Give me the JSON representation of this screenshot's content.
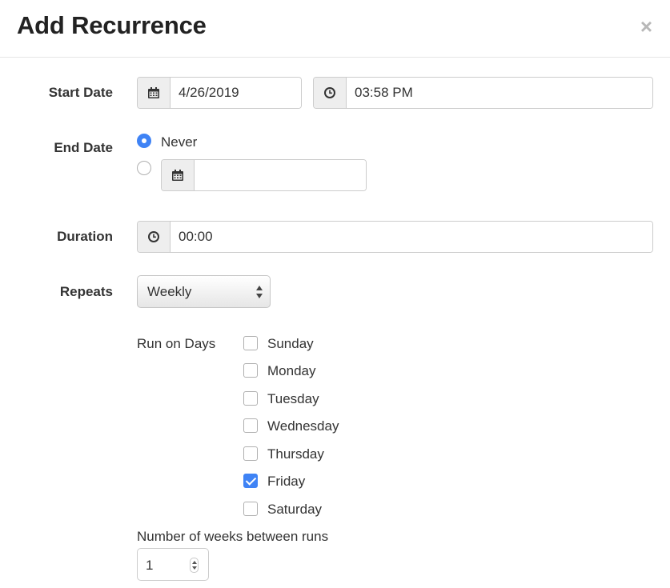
{
  "dialog": {
    "title": "Add Recurrence",
    "close_symbol": "×"
  },
  "start_date": {
    "label": "Start Date",
    "date_value": "4/26/2019",
    "time_value": "03:58 PM",
    "date_icon": "calendar-icon",
    "time_icon": "clock-icon"
  },
  "end_date": {
    "label": "End Date",
    "options": [
      {
        "label": "Never",
        "selected": true
      },
      {
        "label": "",
        "selected": false
      }
    ],
    "date_value": "",
    "date_icon": "calendar-icon"
  },
  "duration": {
    "label": "Duration",
    "value": "00:00",
    "icon": "clock-icon"
  },
  "repeats": {
    "label": "Repeats",
    "selected": "Weekly"
  },
  "run_on_days": {
    "label": "Run on Days",
    "days": [
      {
        "label": "Sunday",
        "checked": false
      },
      {
        "label": "Monday",
        "checked": false
      },
      {
        "label": "Tuesday",
        "checked": false
      },
      {
        "label": "Wednesday",
        "checked": false
      },
      {
        "label": "Thursday",
        "checked": false
      },
      {
        "label": "Friday",
        "checked": true
      },
      {
        "label": "Saturday",
        "checked": false
      }
    ]
  },
  "weeks_between": {
    "label": "Number of weeks between runs",
    "value": "1"
  },
  "colors": {
    "accent": "#3f83f5",
    "addon_bg": "#eeeeee",
    "border": "#cccccc",
    "text": "#333333"
  }
}
